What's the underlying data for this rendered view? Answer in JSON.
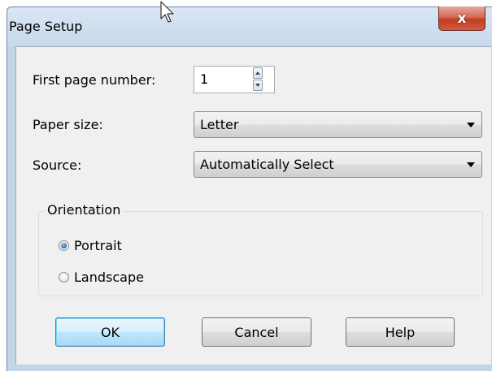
{
  "window": {
    "title": "Page Setup",
    "close_label": "x"
  },
  "fields": {
    "first_page_label": "First page number:",
    "first_page_value": "1",
    "paper_size_label": "Paper size:",
    "paper_size_value": "Letter",
    "source_label": "Source:",
    "source_value": "Automatically Select"
  },
  "orientation": {
    "group_label": "Orientation",
    "options": [
      {
        "label": "Portrait",
        "checked": true
      },
      {
        "label": "Landscape",
        "checked": false
      }
    ]
  },
  "buttons": {
    "ok": "OK",
    "cancel": "Cancel",
    "help": "Help"
  },
  "colors": {
    "title_bar": "#c7d9ec",
    "close_button": "#c23d22",
    "default_button_border": "#3c7fb1"
  },
  "icons": {
    "close": "close-icon",
    "cursor": "mouse-cursor-icon",
    "spin_up": "spin-up-icon",
    "spin_down": "spin-down-icon",
    "dropdown": "chevron-down-icon"
  }
}
